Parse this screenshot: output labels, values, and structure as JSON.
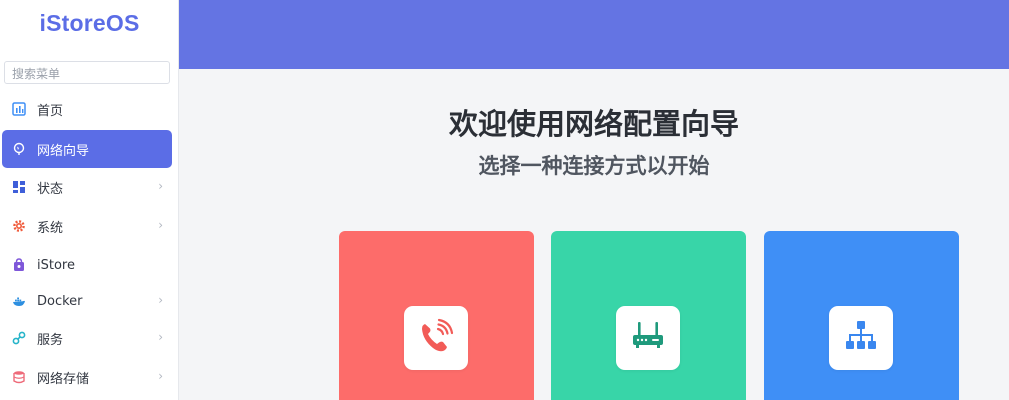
{
  "app": {
    "logo_text": "iStoreOS"
  },
  "sidebar": {
    "search_placeholder": "搜索菜单",
    "items": [
      {
        "label": "首页",
        "icon": "dashboard-icon",
        "active": false,
        "has_submenu": false
      },
      {
        "label": "网络向导",
        "icon": "globe-icon",
        "active": true,
        "has_submenu": false
      },
      {
        "label": "状态",
        "icon": "status-grid-icon",
        "active": false,
        "has_submenu": true
      },
      {
        "label": "系统",
        "icon": "gear-icon",
        "active": false,
        "has_submenu": true
      },
      {
        "label": "iStore",
        "icon": "store-bag-icon",
        "active": false,
        "has_submenu": false
      },
      {
        "label": "Docker",
        "icon": "docker-whale-icon",
        "active": false,
        "has_submenu": true
      },
      {
        "label": "服务",
        "icon": "services-icon",
        "active": false,
        "has_submenu": true
      },
      {
        "label": "网络存储",
        "icon": "storage-icon",
        "active": false,
        "has_submenu": true
      }
    ]
  },
  "main": {
    "title": "欢迎使用网络配置向导",
    "subtitle": "选择一种连接方式以开始",
    "cards": [
      {
        "name": "dial-up",
        "icon": "phone-icon",
        "color": "#fd6c6a"
      },
      {
        "name": "router",
        "icon": "router-icon",
        "color": "#38d5a8"
      },
      {
        "name": "network",
        "icon": "network-topology-icon",
        "color": "#3f8ff6"
      }
    ]
  },
  "colors": {
    "accent": "#5b6de6",
    "header_band": "#6474e3",
    "background": "#f4f5f7"
  }
}
